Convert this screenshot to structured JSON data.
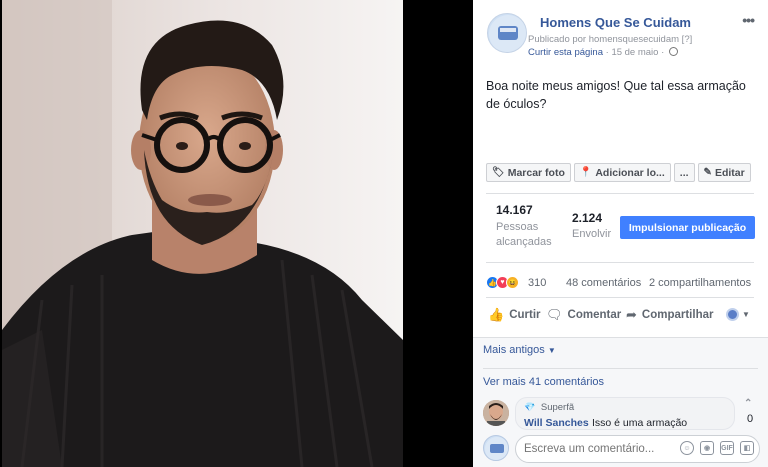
{
  "post": {
    "page_name": "Homens Que Se Cuidam",
    "published_by": "Publicado por homensquesecuidam [?]",
    "like_page": "Curtir esta página",
    "separator": "·",
    "date": "15 de maio",
    "text": "Boa noite meus amigos! Que tal essa armação de óculos?",
    "more_icon": "more-dots-icon"
  },
  "photo_toolbar": {
    "tag_photo": "Marcar foto",
    "add_location": "Adicionar lo...",
    "more": "...",
    "edit": "Editar"
  },
  "insights": {
    "reached_count": "14.167",
    "reached_label": "Pessoas alcançadas",
    "engagement_count": "2.124",
    "engagement_label": "Envolvir",
    "boost_button": "Impulsionar publicação"
  },
  "reactions": {
    "count": "310",
    "comments": "48 comentários",
    "shares": "2 compartilhamentos",
    "types": [
      "like",
      "love",
      "haha"
    ]
  },
  "actions": {
    "like": "Curtir",
    "comment": "Comentar",
    "share": "Compartilhar"
  },
  "comments": {
    "older": "Mais antigos",
    "view_more": "Ver mais 41 comentários",
    "first": {
      "badge": "Superfã",
      "author": "Will Sanches",
      "text": "Isso é uma armação",
      "likes": "0"
    }
  },
  "composer": {
    "placeholder": "Escreva um comentário..."
  },
  "colors": {
    "link": "#365899",
    "boost": "#4080ff",
    "like": "#1877f2",
    "love": "#f33e58",
    "haha": "#f7b125"
  }
}
